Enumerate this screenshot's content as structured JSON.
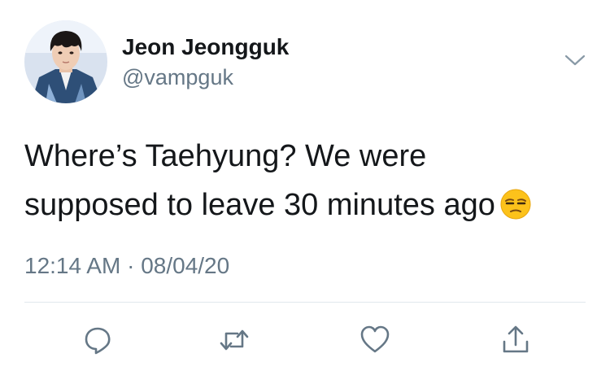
{
  "author": {
    "display_name": "Jeon Jeongguk",
    "handle": "@vampguk",
    "avatar_icon": "profile-photo"
  },
  "tweet": {
    "line1": "Where’s Taehyung? We were",
    "line2": "supposed to leave 30 minutes ago",
    "emoji": "unamused-face-emoji",
    "time": "12:14 AM",
    "separator": "·",
    "date": "08/04/20"
  },
  "actions": {
    "reply_icon": "reply-icon",
    "retweet_icon": "retweet-icon",
    "like_icon": "heart-icon",
    "share_icon": "share-icon"
  },
  "colors": {
    "text": "#14171a",
    "secondary": "#657786",
    "divider": "#e1e8ed"
  }
}
